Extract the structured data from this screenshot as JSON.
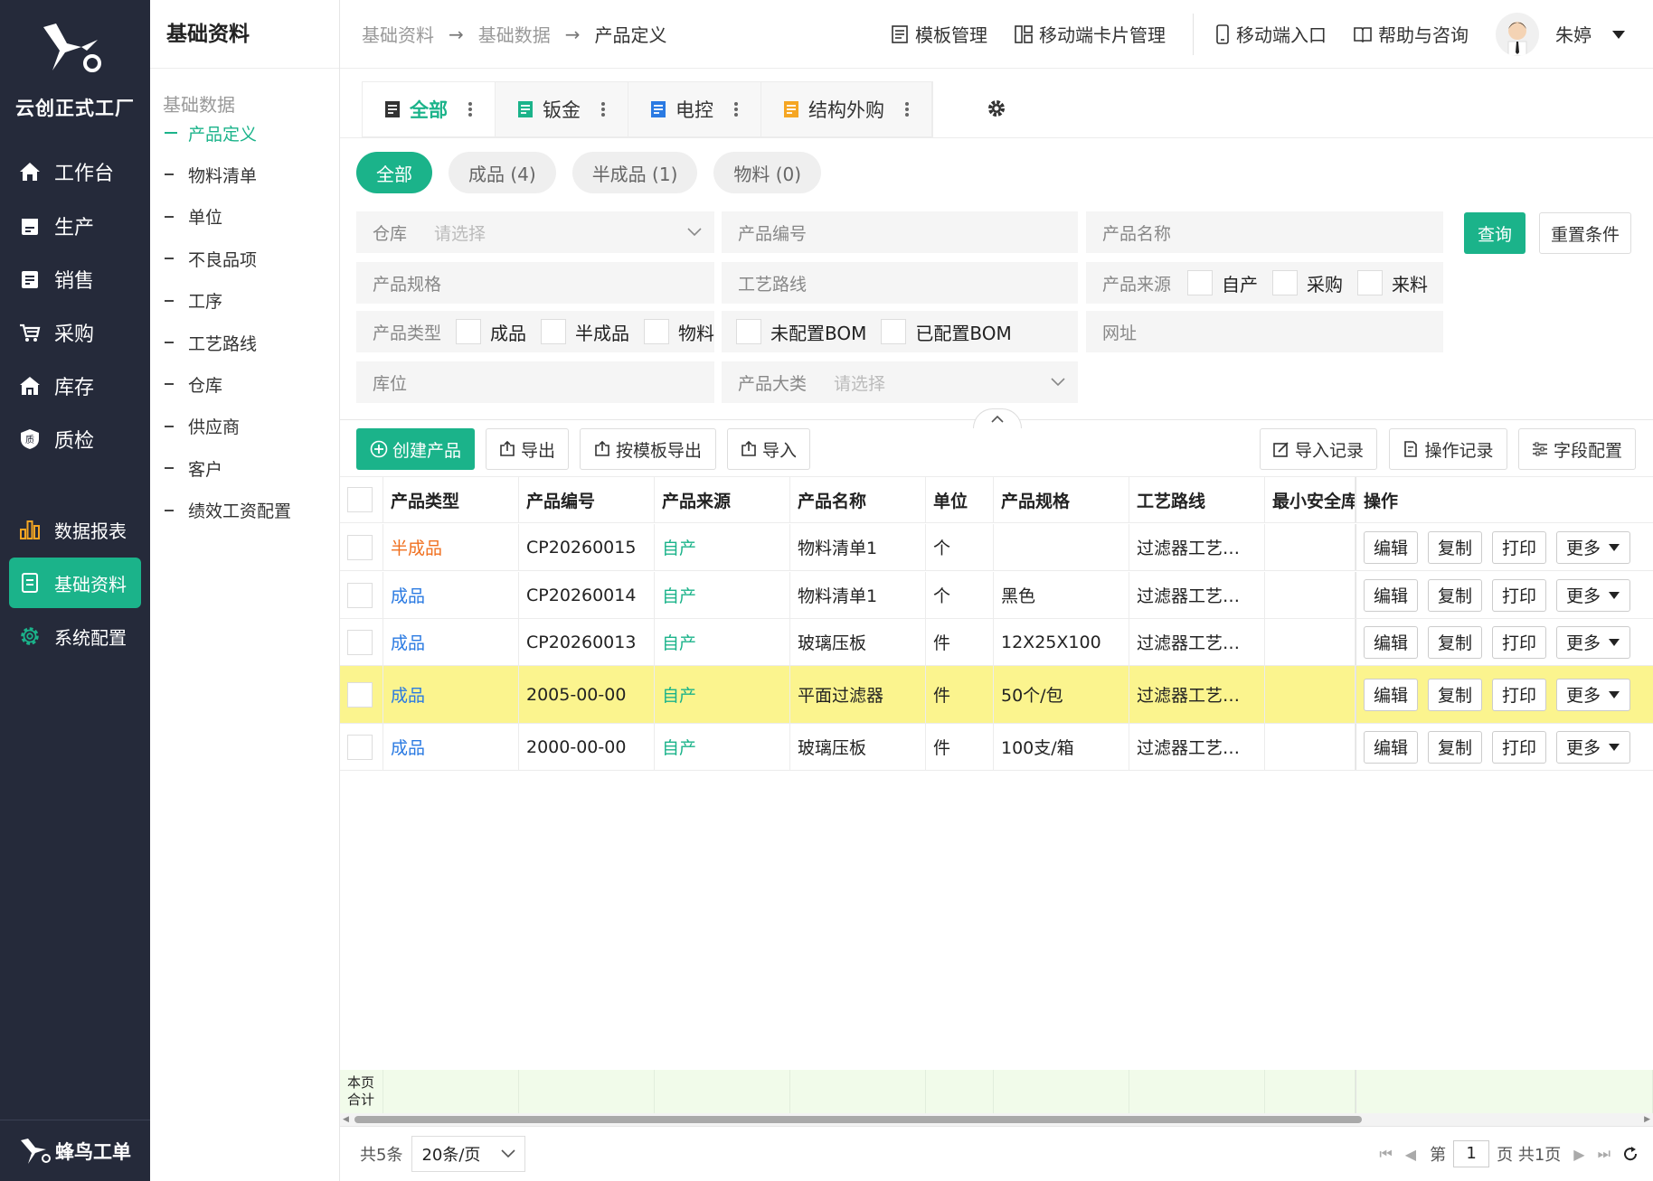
{
  "app": {
    "name": "云创正式工厂",
    "brand": "蜂鸟工单",
    "accent": "#1bb38a"
  },
  "nav": {
    "items": [
      {
        "label": "工作台",
        "icon": "home-icon"
      },
      {
        "label": "生产",
        "icon": "production-icon"
      },
      {
        "label": "销售",
        "icon": "sales-icon"
      },
      {
        "label": "采购",
        "icon": "cart-icon"
      },
      {
        "label": "库存",
        "icon": "warehouse-icon"
      },
      {
        "label": "质检",
        "icon": "shield-icon"
      },
      {
        "label": "数据报表",
        "icon": "bar-chart-icon"
      },
      {
        "label": "基础资料",
        "icon": "document-icon"
      },
      {
        "label": "系统配置",
        "icon": "gear-icon"
      }
    ]
  },
  "subnav": {
    "title": "基础资料",
    "group": "基础数据",
    "items": [
      "产品定义",
      "物料清单",
      "单位",
      "不良品项",
      "工序",
      "工艺路线",
      "仓库",
      "供应商",
      "客户",
      "绩效工资配置"
    ]
  },
  "breadcrumb": [
    "基础资料",
    "基础数据",
    "产品定义"
  ],
  "breadcrumb_sep": "→",
  "toolbar": {
    "template": "模板管理",
    "mobile_card": "移动端卡片管理",
    "mobile_entry": "移动端入口",
    "help": "帮助与咨询",
    "user": "朱婷"
  },
  "tabs": [
    {
      "label": "全部",
      "color": "#333333"
    },
    {
      "label": "钣金",
      "color": "#1bb38a"
    },
    {
      "label": "电控",
      "color": "#2a7ae2"
    },
    {
      "label": "结构外购",
      "color": "#f5a623"
    }
  ],
  "pills": [
    "全部",
    "成品 (4)",
    "半成品 (1)",
    "物料 (0)"
  ],
  "filters": {
    "warehouse": "仓库",
    "warehouse_ph": "请选择",
    "code": "产品编号",
    "name": "产品名称",
    "spec": "产品规格",
    "route": "工艺路线",
    "source": "产品来源",
    "source_opts": [
      "自产",
      "采购",
      "来料"
    ],
    "type": "产品类型",
    "type_opts": [
      "成品",
      "半成品",
      "物料"
    ],
    "bom_opts": [
      "未配置BOM",
      "已配置BOM"
    ],
    "url": "网址",
    "location": "库位",
    "category": "产品大类",
    "category_ph": "请选择",
    "query": "查询",
    "reset": "重置条件"
  },
  "actions": {
    "create": "创建产品",
    "export": "导出",
    "export_tpl": "按模板导出",
    "import": "导入",
    "import_log": "导入记录",
    "op_log": "操作记录",
    "fields": "字段配置"
  },
  "table": {
    "headers": [
      "产品类型",
      "产品编号",
      "产品来源",
      "产品名称",
      "单位",
      "产品规格",
      "工艺路线",
      "最小安全库",
      "操作"
    ],
    "row_actions": [
      "编辑",
      "复制",
      "打印",
      "更多"
    ],
    "rows": [
      {
        "type": "半成品",
        "code": "CP20260015",
        "source": "自产",
        "name": "物料清单1",
        "unit": "个",
        "spec": "",
        "route": "过滤器工艺…",
        "min": ""
      },
      {
        "type": "成品",
        "code": "CP20260014",
        "source": "自产",
        "name": "物料清单1",
        "unit": "个",
        "spec": "黑色",
        "route": "过滤器工艺…",
        "min": ""
      },
      {
        "type": "成品",
        "code": "CP20260013",
        "source": "自产",
        "name": "玻璃压板",
        "unit": "件",
        "spec": "12X25X100",
        "route": "过滤器工艺…",
        "min": ""
      },
      {
        "type": "成品",
        "code": "2005-00-00",
        "source": "自产",
        "name": "平面过滤器",
        "unit": "件",
        "spec": "50个/包",
        "route": "过滤器工艺…",
        "min": "",
        "highlight": true
      },
      {
        "type": "成品",
        "code": "2000-00-00",
        "source": "自产",
        "name": "玻璃压板",
        "unit": "件",
        "spec": "100支/箱",
        "route": "过滤器工艺…",
        "min": ""
      }
    ],
    "summary_label": [
      "本页",
      "合计"
    ]
  },
  "pager": {
    "total": "共5条",
    "size": "20条/页",
    "page_prefix": "第",
    "page": "1",
    "page_suffix": "页 共1页"
  }
}
